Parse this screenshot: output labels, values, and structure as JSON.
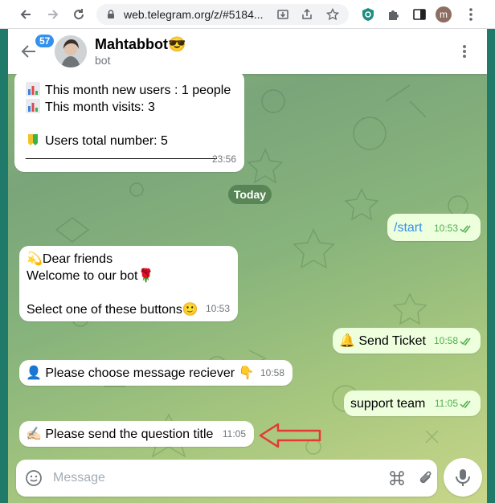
{
  "browser": {
    "url": "web.telegram.org/z/#5184...",
    "profile_initial": "m"
  },
  "header": {
    "unread_count": "57",
    "chat_name": "Mahtabbot😎",
    "chat_status": "bot"
  },
  "messages": [
    {
      "direction": "in",
      "lines": [
        "This month new users : 1 people",
        "This month visits: 3",
        "",
        "Users total number: 5",
        "______________________________"
      ],
      "time": "23:56"
    },
    {
      "type": "date",
      "label": "Today"
    },
    {
      "direction": "out",
      "text": "/start",
      "time": "10:53"
    },
    {
      "direction": "in",
      "lines": [
        "💫Dear friends",
        "Welcome to our bot🌹",
        "",
        "Select one of these buttons🙂"
      ],
      "time": "10:53"
    },
    {
      "direction": "out",
      "text": "🔔 Send Ticket",
      "time": "10:58"
    },
    {
      "direction": "in",
      "text": "👤 Please choose message reciever 👇",
      "time": "10:58"
    },
    {
      "direction": "out",
      "text": "support team",
      "time": "11:05"
    },
    {
      "direction": "in",
      "text": "✍🏻 Please send the question title",
      "time": "11:05"
    }
  ],
  "composer": {
    "placeholder": "Message"
  },
  "colors": {
    "accent": "#3390ec",
    "outgoing_bubble": "#eeffde",
    "outgoing_time": "#4fae4e",
    "annotation_arrow": "#e53935"
  },
  "icons": [
    "back-arrow-icon",
    "forward-arrow-icon",
    "reload-icon",
    "lock-icon",
    "install-icon",
    "share-icon",
    "star-icon",
    "extension-icon",
    "puzzle-icon",
    "sidebar-icon",
    "kebab-menu-icon",
    "emoji-icon",
    "command-icon",
    "attach-icon",
    "mic-icon"
  ]
}
